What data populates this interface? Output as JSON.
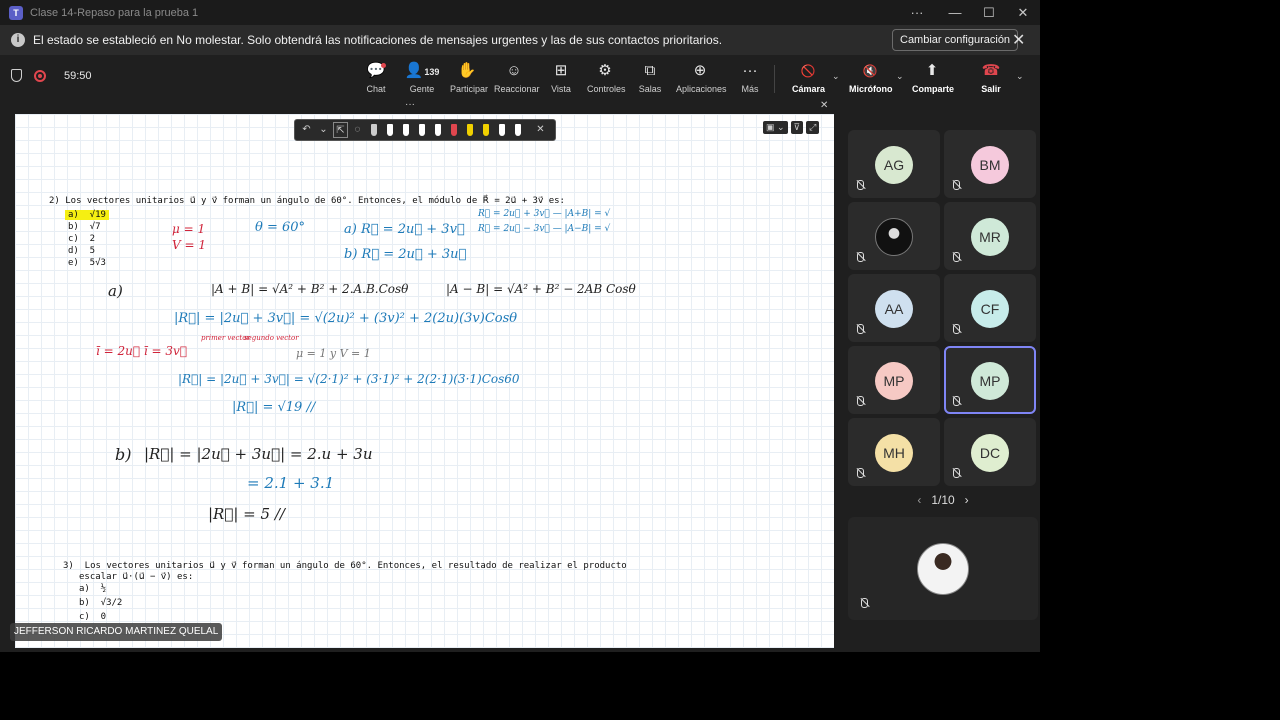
{
  "window": {
    "title": "Clase 14-Repaso para la prueba 1",
    "more": "···",
    "minimize": "—",
    "maximize": "☐",
    "close": "✕"
  },
  "banner": {
    "message": "El estado se estableció en No molestar. Solo obtendrá las notificaciones de mensajes urgentes y las de sus contactos prioritarios.",
    "button": "Cambiar configuración",
    "close": "✕"
  },
  "meeting": {
    "timer": "59:50"
  },
  "toolbar": {
    "chat": {
      "label": "Chat",
      "icon": "💬"
    },
    "people": {
      "label": "Gente",
      "count": "139",
      "icon": "👤"
    },
    "participate": {
      "label": "Participar",
      "icon": "✋"
    },
    "react": {
      "label": "Reaccionar",
      "icon": "☺"
    },
    "view": {
      "label": "Vista",
      "icon": "⊞"
    },
    "controls": {
      "label": "Controles",
      "icon": "⚙"
    },
    "rooms": {
      "label": "Salas",
      "icon": "⧉"
    },
    "apps": {
      "label": "Aplicaciones",
      "icon": "⊕"
    },
    "more": {
      "label": "Más",
      "icon": "···"
    },
    "camera": {
      "label": "Cámara",
      "icon": "🚫"
    },
    "mic": {
      "label": "Micrófono",
      "icon": "🔇"
    },
    "share": {
      "label": "Comparte",
      "icon": "⬆"
    },
    "leave": {
      "label": "Salir",
      "icon": "☎"
    }
  },
  "stage": {
    "top_dots": "···",
    "top_close": "✕",
    "ink_tools": [
      "↶",
      "⌄",
      "⇱",
      "◌"
    ],
    "pen_colors": [
      "#cccccc",
      "#ffffff",
      "#ffffff",
      "#ffffff",
      "#ffffff",
      "#e0464e",
      "#f0d000",
      "#f0d000",
      "#ffffff",
      "#ffffff"
    ],
    "ink_close": "✕",
    "right_tools": [
      "▣ ⌄",
      "⊽",
      "⤢"
    ],
    "doc": {
      "q2_stem": "2) Los vectores unitarios u⃗ y v⃗ forman un ángulo de 60°. Entonces, el módulo de R⃗ = 2u⃗ + 3v⃗ es:",
      "q2_options": [
        "a)  √19",
        "b)  √7",
        "c)  2",
        "d)  5",
        "e)  5√3"
      ],
      "q3_stem_1": "3)  Los vectores unitarios u⃗ y v⃗ forman un ángulo de 60°. Entonces, el resultado de realizar el producto",
      "q3_stem_2": "escalar u⃗·(u⃗ − v⃗) es:",
      "q3_options": [
        "a)  ½",
        "b)  √3/2",
        "c)  0"
      ]
    },
    "ink": {
      "mu": "μ = 1",
      "v": "V = 1",
      "theta": "θ = 60°",
      "a_part": "a)   R⃗ = 2u⃗ + 3v⃗",
      "b_part": "b)   R⃗ = 2u⃗ + 3u⃗",
      "side1": "R⃗ = 2u⃗ + 3v⃗  — |A+B| = √",
      "side2": "R⃗ = 2u⃗ − 3v⃗  — |A−B| = √",
      "a_label": "a)",
      "law_plus": "|A + B| = √A² + B² + 2.A.B.Cosθ",
      "law_minus": "|A − B| = √A² + B² − 2AB Cosθ",
      "step1": "|R⃗| = |2u⃗ + 3v⃗| = √(2u)² + (3v)² + 2(2u)(3v)Cosθ",
      "note1": "primer vector",
      "note2": "segundo vector",
      "red_eq": "ī = 2u⃗   ī = 3v⃗",
      "cond": "μ = 1  y  V = 1",
      "step2": "|R⃗| = |2u⃗ + 3v⃗| = √(2·1)² + (3·1)² + 2(2·1)(3·1)Cos60",
      "result": "|R⃗| = √19 //",
      "b_label": "b)",
      "b_step1": "|R⃗| = |2u⃗ + 3u⃗| =   2.u + 3u",
      "b_step2": "= 2.1 + 3.1",
      "b_result": "|R⃗| = 5 //"
    }
  },
  "presenter_name": "JEFFERSON RICARDO MARTINEZ QUELAL",
  "participants": [
    {
      "initials": "AG",
      "color": "#d8e8d0"
    },
    {
      "initials": "BM",
      "color": "#f5c9dc"
    },
    {
      "initials": "",
      "color": "#2a2a2a"
    },
    {
      "initials": "MR",
      "color": "#cfe9d8"
    },
    {
      "initials": "AA",
      "color": "#cfe0ef"
    },
    {
      "initials": "CF",
      "color": "#c7ecea"
    },
    {
      "initials": "MP",
      "color": "#f6c9c4"
    },
    {
      "initials": "MP",
      "color": "#cfe9d8"
    },
    {
      "initials": "MH",
      "color": "#f4e0a6"
    },
    {
      "initials": "DC",
      "color": "#dfeed0"
    }
  ],
  "pager": {
    "prev": "‹",
    "label": "1/10",
    "next": "›"
  }
}
